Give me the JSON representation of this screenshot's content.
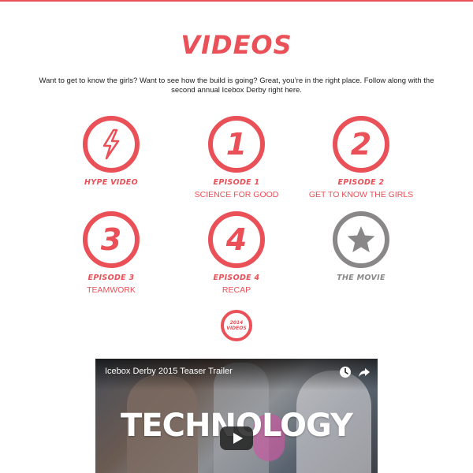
{
  "page": {
    "title": "VIDEOS",
    "intro": "Want to get to know the girls? Want to see how the build is going? Great, you’re in the right place. Follow along with the second annual Icebox Derby right here."
  },
  "colors": {
    "accent": "#ea5057",
    "muted": "#8a8788"
  },
  "videos": [
    {
      "icon": "lightning-bolt-icon",
      "kicker": "HYPE VIDEO",
      "subtitle": ""
    },
    {
      "icon": "number-1-icon",
      "number": "1",
      "kicker": "EPISODE 1",
      "subtitle": "SCIENCE FOR GOOD"
    },
    {
      "icon": "number-2-icon",
      "number": "2",
      "kicker": "EPISODE 2",
      "subtitle": "GET TO KNOW THE GIRLS"
    },
    {
      "icon": "number-3-icon",
      "number": "3",
      "kicker": "EPISODE 3",
      "subtitle": "TEAMWORK"
    },
    {
      "icon": "number-4-icon",
      "number": "4",
      "kicker": "EPISODE 4",
      "subtitle": "RECAP"
    },
    {
      "icon": "star-icon",
      "kicker": "THE MOVIE",
      "subtitle": ""
    }
  ],
  "badge": {
    "line1": "2014",
    "line2": "VIDEOS"
  },
  "embed": {
    "title": "Icebox Derby 2015 Teaser Trailer",
    "overlay_text": "TECHNOLOGY",
    "controls": [
      "clock-icon",
      "share-icon",
      "play-icon"
    ]
  }
}
